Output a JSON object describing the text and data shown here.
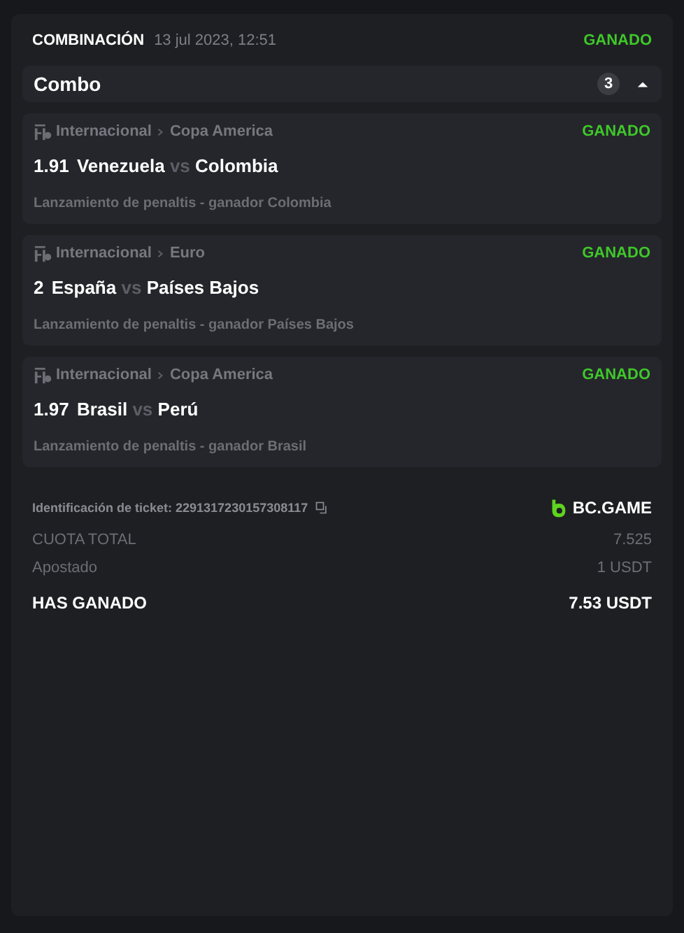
{
  "bet": {
    "type": "COMBINACIÓN",
    "date": "13 jul 2023, 12:51",
    "status": "GANADO"
  },
  "combo": {
    "title": "Combo",
    "count": "3",
    "expanded": true
  },
  "legs": [
    {
      "category": "Internacional",
      "league": "Copa America",
      "status": "GANADO",
      "odds": "1.91",
      "home": "Venezuela",
      "vs": "vs",
      "away": "Colombia",
      "market": "Lanzamiento de penaltis - ganador Colombia"
    },
    {
      "category": "Internacional",
      "league": "Euro",
      "status": "GANADO",
      "odds": "2",
      "home": "España",
      "vs": "vs",
      "away": "Países Bajos",
      "market": "Lanzamiento de penaltis - ganador Países Bajos"
    },
    {
      "category": "Internacional",
      "league": "Copa America",
      "status": "GANADO",
      "odds": "1.97",
      "home": "Brasil",
      "vs": "vs",
      "away": "Perú",
      "market": "Lanzamiento de penaltis - ganador Brasil"
    }
  ],
  "ticket": {
    "label": "Identificación de ticket: 2291317230157308117",
    "brand": "BC.GAME"
  },
  "summary": [
    {
      "label": "CUOTA TOTAL",
      "value": "7.525",
      "kind": "muted"
    },
    {
      "label": "Apostado",
      "value": "1 USDT",
      "kind": "muted"
    },
    {
      "label": "HAS GANADO",
      "value": "7.53 USDT",
      "kind": "total"
    }
  ]
}
